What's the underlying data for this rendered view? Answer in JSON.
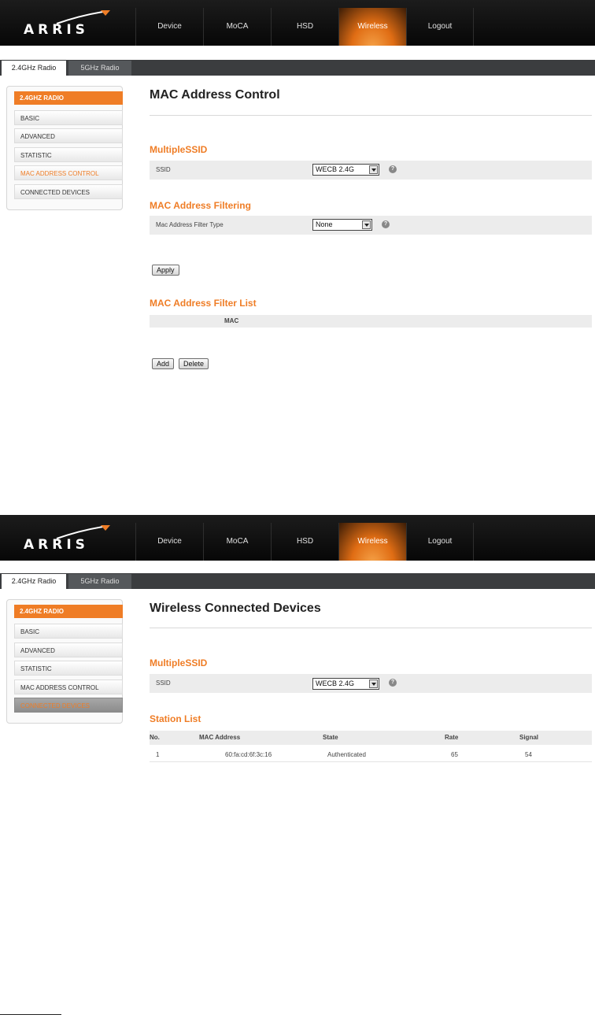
{
  "brand": {
    "logo_text": "ARRIS"
  },
  "colors": {
    "accent": "#ef7d26",
    "header_bg": "#0d0d0d",
    "tabs_bg": "#3b3d3f",
    "row_bg": "#ececec"
  },
  "nav": [
    "Device",
    "MoCA",
    "HSD",
    "Wireless",
    "Logout"
  ],
  "nav_active": "Wireless",
  "tabs": {
    "active": "2.4GHz Radio",
    "inactive": "5GHz Radio"
  },
  "sidebar": {
    "header": "2.4GHZ RADIO",
    "items": [
      "BASIC",
      "ADVANCED",
      "STATISTIC",
      "MAC ADDRESS CONTROL",
      "CONNECTED DEVICES"
    ]
  },
  "screen1": {
    "title": "MAC Address Control",
    "multiple_ssid": {
      "title": "MultipleSSID",
      "label": "SSID",
      "value": "WECB 2.4G"
    },
    "filtering": {
      "title": "MAC Address Filtering",
      "label": "Mac Address Filter Type",
      "value": "None"
    },
    "apply_label": "Apply",
    "filter_list": {
      "title": "MAC Address Filter List",
      "column": "MAC"
    },
    "add_label": "Add",
    "delete_label": "Delete",
    "selected_item": "MAC ADDRESS CONTROL"
  },
  "screen2": {
    "title": "Wireless Connected Devices",
    "multiple_ssid": {
      "title": "MultipleSSID",
      "label": "SSID",
      "value": "WECB 2.4G"
    },
    "station_list": {
      "title": "Station List",
      "columns": [
        "No.",
        "MAC Address",
        "State",
        "Rate",
        "Signal"
      ],
      "rows": [
        [
          "1",
          "60:fa:cd:6f:3c:16",
          "Authenticated",
          "65",
          "54"
        ]
      ]
    },
    "selected_item": "CONNECTED DEVICES"
  },
  "help_glyph": "?"
}
